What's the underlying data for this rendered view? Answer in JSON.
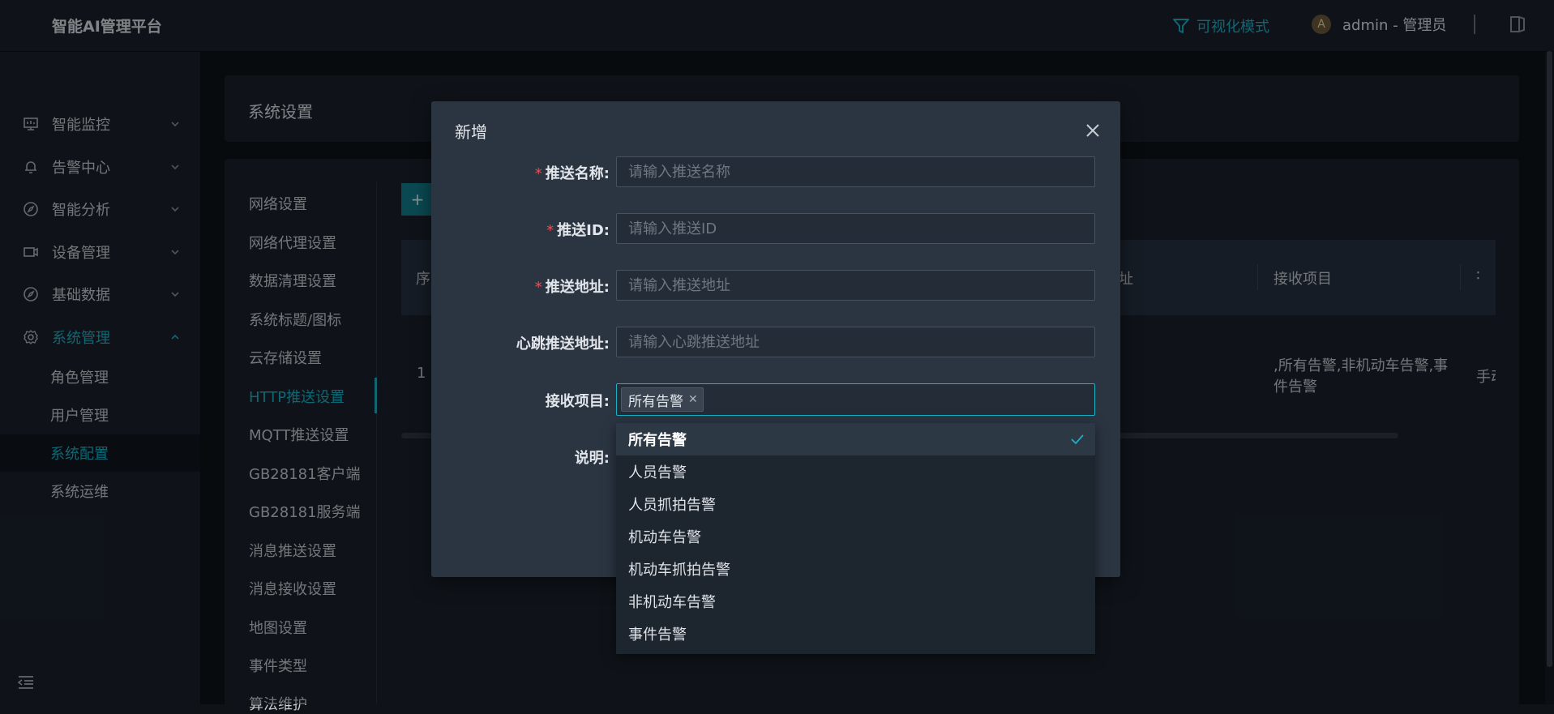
{
  "header": {
    "logo": "智能AI管理平台",
    "vis_mode": "可视化模式",
    "avatar_letter": "A",
    "user": "admin - 管理员"
  },
  "sidebar": {
    "menu": [
      {
        "label": "智能监控",
        "icon": "monitor-icon"
      },
      {
        "label": "告警中心",
        "icon": "bell-icon"
      },
      {
        "label": "智能分析",
        "icon": "compass-icon"
      },
      {
        "label": "设备管理",
        "icon": "camera-icon"
      },
      {
        "label": "基础数据",
        "icon": "compass-icon"
      },
      {
        "label": "系统管理",
        "icon": "gear-icon"
      }
    ],
    "submenu": [
      "角色管理",
      "用户管理",
      "系统配置",
      "系统运维"
    ]
  },
  "page": {
    "title": "系统设置",
    "subnav": [
      "网络设置",
      "网络代理设置",
      "数据清理设置",
      "系统标题/图标",
      "云存储设置",
      "HTTP推送设置",
      "MQTT推送设置",
      "GB28181客户端",
      "GB28181服务端",
      "消息推送设置",
      "消息接收设置",
      "地图设置",
      "事件类型",
      "算法维护"
    ],
    "add_button": "+",
    "table": {
      "headers": [
        "序",
        "址",
        "接收项目",
        "∶"
      ],
      "row": {
        "index": "1",
        "receive_items_line1": ",所有告警,非机动车告警,事",
        "receive_items_line2": "件告警",
        "extra": "手动"
      }
    }
  },
  "modal": {
    "title": "新增",
    "fields": [
      {
        "label": "推送名称:",
        "required": true,
        "placeholder": "请输入推送名称"
      },
      {
        "label": "推送ID:",
        "required": true,
        "placeholder": "请输入推送ID"
      },
      {
        "label": "推送地址:",
        "required": true,
        "placeholder": "请输入推送地址"
      },
      {
        "label": "心跳推送地址:",
        "required": false,
        "placeholder": "请输入心跳推送地址"
      }
    ],
    "receive_label": "接收项目:",
    "receive_tag": "所有告警",
    "note_label": "说明:"
  },
  "dropdown": {
    "options": [
      "所有告警",
      "人员告警",
      "人员抓拍告警",
      "机动车告警",
      "机动车抓拍告警",
      "非机动车告警",
      "事件告警"
    ],
    "selected": "所有告警"
  },
  "colors": {
    "accent": "#19b1c6",
    "required": "#e0515a",
    "panel": "#1a222c",
    "modal": "#2b3542"
  }
}
